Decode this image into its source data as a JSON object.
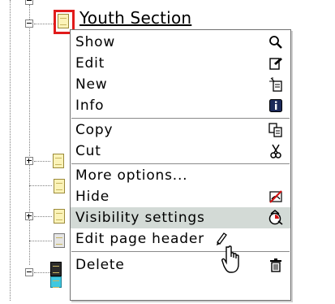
{
  "tree": {
    "selected_node_label": "Youth Section"
  },
  "context_menu": {
    "groups": [
      [
        {
          "label": "Show",
          "icon": "magnifier-icon"
        },
        {
          "label": "Edit",
          "icon": "edit-page-icon"
        },
        {
          "label": "New",
          "icon": "new-page-icon"
        },
        {
          "label": "Info",
          "icon": "info-icon"
        }
      ],
      [
        {
          "label": "Copy",
          "icon": "copy-icon"
        },
        {
          "label": "Cut",
          "icon": "scissors-icon"
        }
      ],
      [
        {
          "label": "More options...",
          "icon": ""
        },
        {
          "label": "Hide",
          "icon": "hide-icon"
        },
        {
          "label": "Visibility settings",
          "icon": "visibility-icon",
          "hovered": true
        },
        {
          "label": "Edit page header",
          "icon": "pen-icon"
        }
      ],
      [
        {
          "label": "Delete",
          "icon": "trash-icon"
        }
      ]
    ],
    "hover_color": "#d3dad6",
    "selection_border_color": "#e11b1b"
  }
}
